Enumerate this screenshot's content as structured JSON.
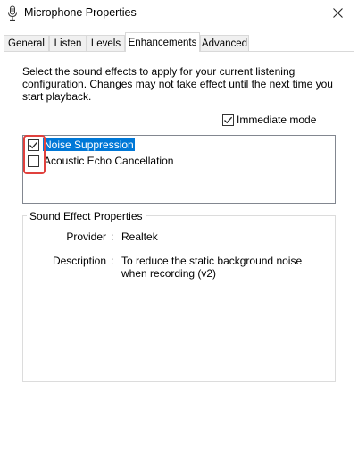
{
  "window": {
    "title": "Microphone Properties",
    "icon": "microphone-icon",
    "close_icon": "close-icon"
  },
  "tabs": [
    {
      "label": "General",
      "active": false
    },
    {
      "label": "Listen",
      "active": false
    },
    {
      "label": "Levels",
      "active": false
    },
    {
      "label": "Enhancements",
      "active": true
    },
    {
      "label": "Advanced",
      "active": false
    }
  ],
  "enhancements": {
    "description": "Select the sound effects to apply for your current listening configuration. Changes may not take effect until the next time you start playback.",
    "immediate_mode": {
      "label": "Immediate mode",
      "checked": true
    },
    "effects": [
      {
        "label": "Noise Suppression",
        "checked": true,
        "selected": true
      },
      {
        "label": "Acoustic Echo Cancellation",
        "checked": false,
        "selected": false
      }
    ]
  },
  "properties": {
    "group_title": "Sound Effect Properties",
    "provider_label": "Provider",
    "provider_value": "Realtek",
    "description_label": "Description",
    "description_value": "To reduce the static background noise when recording (v2)",
    "colon": ":"
  },
  "colors": {
    "selection": "#0078d7",
    "highlight": "#e0413e"
  }
}
